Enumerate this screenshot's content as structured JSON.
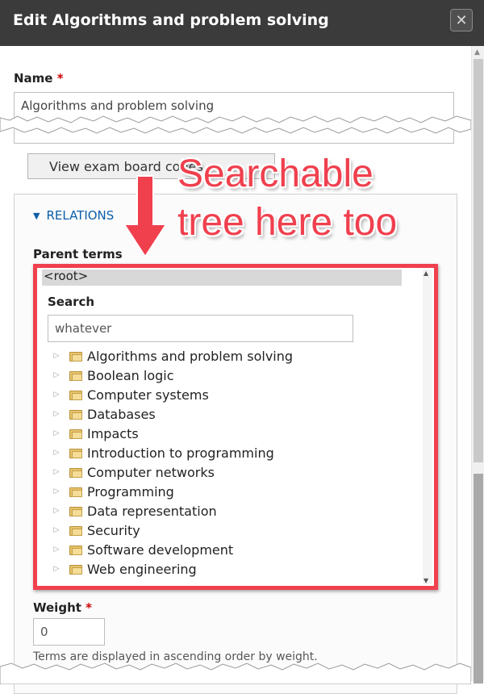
{
  "dialog": {
    "title": "Edit Algorithms and problem solving",
    "close_glyph": "✕"
  },
  "form": {
    "name_label": "Name",
    "required_mark": "*",
    "name_value": "Algorithms and problem solving",
    "exam_button_label": "View exam board codes",
    "relations_toggle": "RELATIONS",
    "relations_triangle": "▼",
    "parent_terms_label": "Parent terms",
    "root_option": "<root>",
    "search_label": "Search",
    "search_value": "whatever",
    "tree_items": [
      "Algorithms and problem solving",
      "Boolean logic",
      "Computer systems",
      "Databases",
      "Impacts",
      "Introduction to programming",
      "Computer networks",
      "Programming",
      "Data representation",
      "Security",
      "Software development",
      "Web engineering"
    ],
    "weight_label": "Weight",
    "weight_value": "0",
    "weight_help": "Terms are displayed in ascending order by weight."
  },
  "annotation": {
    "line1": "Searchable",
    "line2": "tree here too",
    "color": "#f0404e"
  },
  "icons": {
    "expander": "▷",
    "folder": "folder-icon"
  }
}
